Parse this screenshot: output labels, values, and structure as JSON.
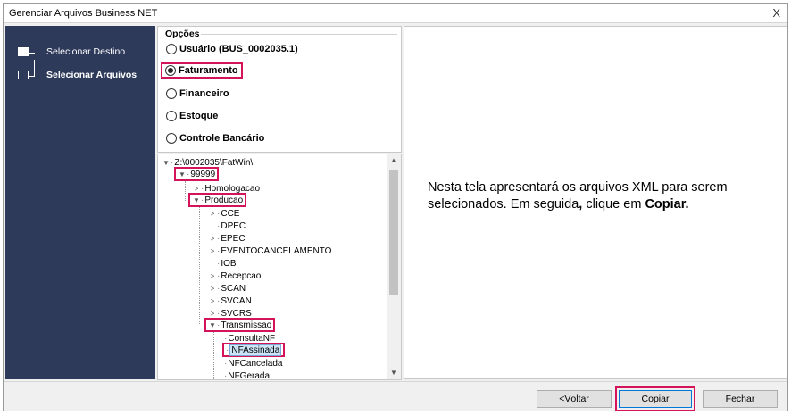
{
  "window": {
    "title": "Gerenciar Arquivos Business NET",
    "close_label": "X"
  },
  "sidebar": {
    "steps": [
      {
        "label": "Selecionar Destino"
      },
      {
        "label": "Selecionar Arquivos"
      }
    ]
  },
  "options": {
    "title": "Opções",
    "items": [
      {
        "label": "Usuário (BUS_0002035.1)",
        "checked": false
      },
      {
        "label": "Faturamento",
        "checked": true
      },
      {
        "label": "Financeiro",
        "checked": false
      },
      {
        "label": "Estoque",
        "checked": false
      },
      {
        "label": "Controle Bancário",
        "checked": false
      }
    ]
  },
  "tree": {
    "nodes": [
      {
        "label": "Z:\\0002035\\FatWin\\"
      },
      {
        "label": "99999"
      },
      {
        "label": "Homologacao"
      },
      {
        "label": "Producao"
      },
      {
        "label": "CCE"
      },
      {
        "label": "DPEC"
      },
      {
        "label": "EPEC"
      },
      {
        "label": "EVENTOCANCELAMENTO"
      },
      {
        "label": "IOB"
      },
      {
        "label": "Recepcao"
      },
      {
        "label": "SCAN"
      },
      {
        "label": "SVCAN"
      },
      {
        "label": "SVCRS"
      },
      {
        "label": "Transmissao"
      },
      {
        "label": "ConsultaNF"
      },
      {
        "label": "NFAssinada"
      },
      {
        "label": "NFCancelada"
      },
      {
        "label": "NFGerada"
      }
    ]
  },
  "info": {
    "text_part1": "Nesta tela apresentará os arquivos XML para serem selecionados. Em seguida",
    "text_comma": ",",
    "text_part2": " clique em ",
    "text_bold": "Copiar."
  },
  "footer": {
    "back_prefix": "< ",
    "back_key": "V",
    "back_rest": "oltar",
    "copy_key": "C",
    "copy_rest": "opiar",
    "close_label": "Fechar"
  }
}
